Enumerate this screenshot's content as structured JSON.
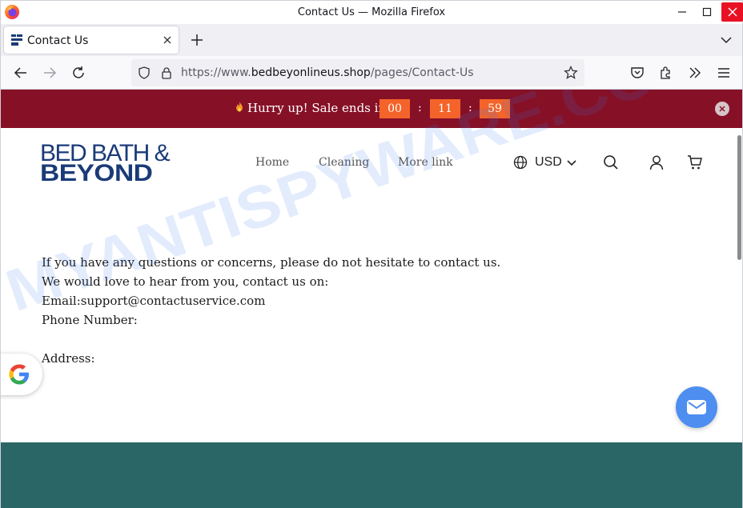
{
  "window": {
    "title": "Contact Us — Mozilla Firefox",
    "icons": [
      "firefox-logo",
      "minimize-icon",
      "maximize-icon",
      "close-icon"
    ]
  },
  "tabs": [
    {
      "label": "Contact Us",
      "active": true
    }
  ],
  "navbar": {
    "url_prefix": "https://www.",
    "url_domain": "bedbeyonlineus.shop",
    "url_path": "/pages/Contact-Us"
  },
  "promo": {
    "text": "Hurry up! Sale ends in",
    "hours": "00",
    "minutes": "11",
    "seconds": "59",
    "sep": ":",
    "bg_color": "#861127",
    "box_color": "#f4632a"
  },
  "header": {
    "logo_line1": "BED BATH &",
    "logo_line2": "BEYOND",
    "menu": [
      "Home",
      "Cleaning",
      "More link"
    ],
    "currency": "USD"
  },
  "content": {
    "lines": [
      "If you have any questions or concerns, please do not hesitate to contact us.",
      "We would love to hear from you, contact us on:",
      "Email:support@contactuservice.com",
      "Phone Number:",
      "",
      "Address:"
    ]
  },
  "watermark": "MYANTISPYWARE.COM",
  "colors": {
    "footer": "#2b6666",
    "chat": "#4d8ef0",
    "logo": "#1a3b78"
  }
}
